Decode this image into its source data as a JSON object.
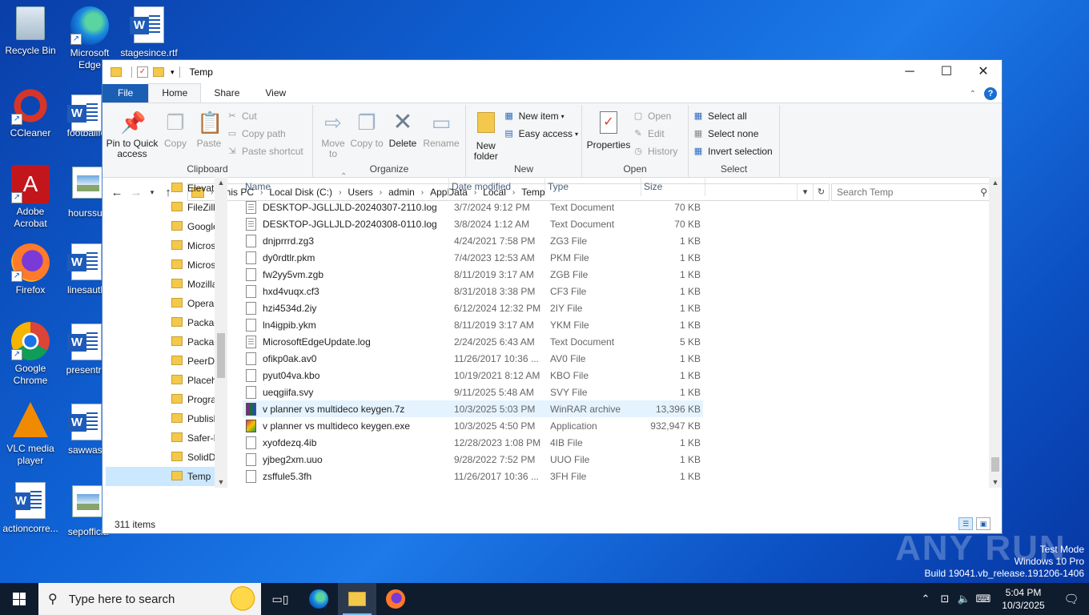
{
  "desktop": {
    "icons": [
      {
        "label": "Recycle Bin"
      },
      {
        "label": "Microsoft Edge"
      },
      {
        "label": "stagesince.rtf"
      },
      {
        "label": "CCleaner"
      },
      {
        "label": "footballfo"
      },
      {
        "label": "Adobe Acrobat"
      },
      {
        "label": "hourssurf"
      },
      {
        "label": "Firefox"
      },
      {
        "label": "linesauth"
      },
      {
        "label": "Google Chrome"
      },
      {
        "label": "presentre"
      },
      {
        "label": "VLC media player"
      },
      {
        "label": "sawwas."
      },
      {
        "label": "actioncorre..."
      },
      {
        "label": "sepofficia"
      }
    ]
  },
  "window": {
    "title": "Temp",
    "controls": {
      "minimize": "─",
      "maximize": "☐",
      "close": "✕"
    },
    "tabs": [
      "File",
      "Home",
      "Share",
      "View"
    ],
    "active_tab": "Home"
  },
  "ribbon": {
    "clipboard": {
      "label": "Clipboard",
      "pin": "Pin to Quick access",
      "copy": "Copy",
      "paste": "Paste",
      "cut": "Cut",
      "copy_path": "Copy path",
      "paste_shortcut": "Paste shortcut"
    },
    "organize": {
      "label": "Organize",
      "move_to": "Move to",
      "copy_to": "Copy to",
      "delete": "Delete",
      "rename": "Rename"
    },
    "new": {
      "label": "New",
      "new_folder": "New folder",
      "new_item": "New item",
      "easy_access": "Easy access"
    },
    "open": {
      "label": "Open",
      "properties": "Properties",
      "open": "Open",
      "edit": "Edit",
      "history": "History"
    },
    "select": {
      "label": "Select",
      "select_all": "Select all",
      "select_none": "Select none",
      "invert": "Invert selection"
    }
  },
  "address": {
    "crumbs": [
      "This PC",
      "Local Disk (C:)",
      "Users",
      "admin",
      "AppData",
      "Local",
      "Temp"
    ],
    "search_placeholder": "Search Temp"
  },
  "nav": {
    "items": [
      {
        "label": "Elevated"
      },
      {
        "label": "FileZilla"
      },
      {
        "label": "Google"
      },
      {
        "label": "Microsoft"
      },
      {
        "label": "Microsoft"
      },
      {
        "label": "Mozilla"
      },
      {
        "label": "Opera"
      },
      {
        "label": "Packages"
      },
      {
        "label": "Packages"
      },
      {
        "label": "PeerDist"
      },
      {
        "label": "Placeholder"
      },
      {
        "label": "Programs"
      },
      {
        "label": "Publish"
      },
      {
        "label": "Safer-N"
      },
      {
        "label": "SolidDocs"
      },
      {
        "label": "Temp"
      }
    ],
    "selected": "Temp"
  },
  "columns": {
    "name": "Name",
    "date": "Date modified",
    "type": "Type",
    "size": "Size"
  },
  "files": [
    {
      "name": "DESKTOP-JGLLJLD-20240307-2110.log",
      "date": "3/7/2024 9:12 PM",
      "type": "Text Document",
      "size": "70 KB",
      "icon": "log"
    },
    {
      "name": "DESKTOP-JGLLJLD-20240308-0110.log",
      "date": "3/8/2024 1:12 AM",
      "type": "Text Document",
      "size": "70 KB",
      "icon": "log"
    },
    {
      "name": "dnjprrrd.zg3",
      "date": "4/24/2021 7:58 PM",
      "type": "ZG3 File",
      "size": "1 KB",
      "icon": "file"
    },
    {
      "name": "dy0rdtlr.pkm",
      "date": "7/4/2023 12:53 AM",
      "type": "PKM File",
      "size": "1 KB",
      "icon": "file"
    },
    {
      "name": "fw2yy5vm.zgb",
      "date": "8/11/2019 3:17 AM",
      "type": "ZGB File",
      "size": "1 KB",
      "icon": "file"
    },
    {
      "name": "hxd4vuqx.cf3",
      "date": "8/31/2018 3:38 PM",
      "type": "CF3 File",
      "size": "1 KB",
      "icon": "file"
    },
    {
      "name": "hzi4534d.2iy",
      "date": "6/12/2024 12:32 PM",
      "type": "2IY File",
      "size": "1 KB",
      "icon": "file"
    },
    {
      "name": "ln4igpib.ykm",
      "date": "8/11/2019 3:17 AM",
      "type": "YKM File",
      "size": "1 KB",
      "icon": "file"
    },
    {
      "name": "MicrosoftEdgeUpdate.log",
      "date": "2/24/2025 6:43 AM",
      "type": "Text Document",
      "size": "5 KB",
      "icon": "log"
    },
    {
      "name": "ofikp0ak.av0",
      "date": "11/26/2017 10:36 ...",
      "type": "AV0 File",
      "size": "1 KB",
      "icon": "file"
    },
    {
      "name": "pyut04va.kbo",
      "date": "10/19/2021 8:12 AM",
      "type": "KBO File",
      "size": "1 KB",
      "icon": "file"
    },
    {
      "name": "ueqgiifa.svy",
      "date": "9/11/2025 5:48 AM",
      "type": "SVY File",
      "size": "1 KB",
      "icon": "file"
    },
    {
      "name": "v planner vs multideco keygen.7z",
      "date": "10/3/2025 5:03 PM",
      "type": "WinRAR archive",
      "size": "13,396 KB",
      "icon": "rar",
      "highlight": true
    },
    {
      "name": "v planner vs multideco keygen.exe",
      "date": "10/3/2025 4:50 PM",
      "type": "Application",
      "size": "932,947 KB",
      "icon": "exe"
    },
    {
      "name": "xyofdezq.4ib",
      "date": "12/28/2023 1:08 PM",
      "type": "4IB File",
      "size": "1 KB",
      "icon": "file"
    },
    {
      "name": "yjbeg2xm.uuo",
      "date": "9/28/2022 7:52 PM",
      "type": "UUO File",
      "size": "1 KB",
      "icon": "file"
    },
    {
      "name": "zsffule5.3fh",
      "date": "11/26/2017 10:36 ...",
      "type": "3FH File",
      "size": "1 KB",
      "icon": "file"
    }
  ],
  "status": {
    "count": "311 items"
  },
  "watermark": {
    "text": "ANY RUN",
    "mode": "Test Mode",
    "os": "Windows 10 Pro",
    "build": "Build 19041.vb_release.191206-1406"
  },
  "taskbar": {
    "search_placeholder": "Type here to search",
    "time": "5:04 PM",
    "date": "10/3/2025"
  }
}
